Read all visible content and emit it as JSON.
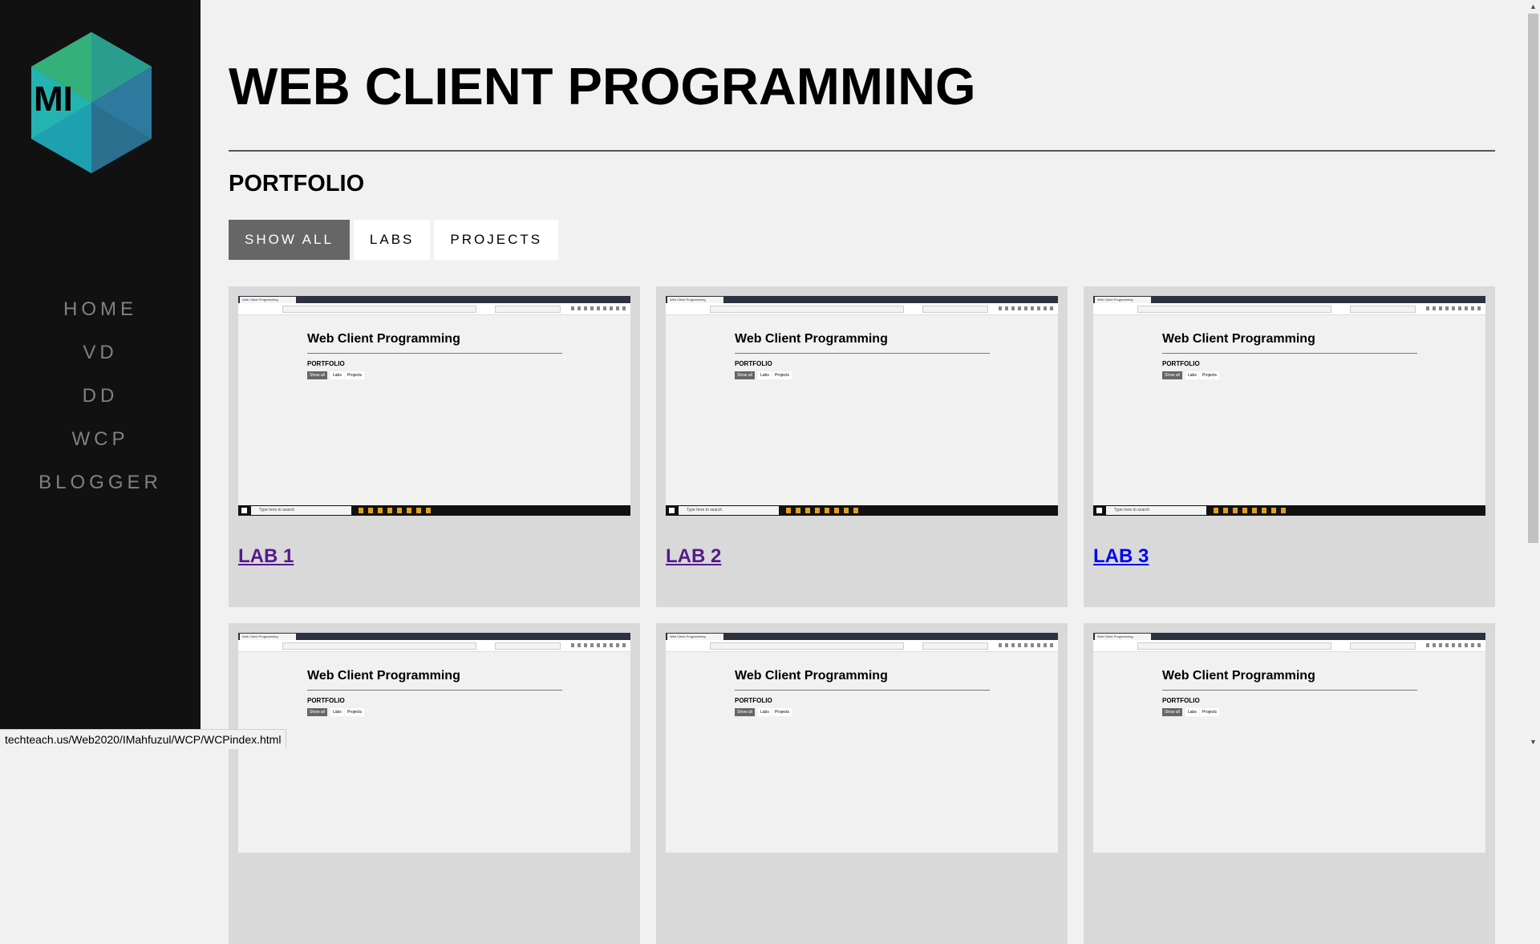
{
  "sidebar": {
    "logo_text": "MI",
    "nav": [
      "HOME",
      "VD",
      "DD",
      "WCP",
      "BLOGGER"
    ]
  },
  "header": {
    "title": "WEB CLIENT PROGRAMMING",
    "section": "PORTFOLIO"
  },
  "filters": {
    "show_all": "SHOW ALL",
    "labs": "LABS",
    "projects": "PROJECTS"
  },
  "cards": [
    {
      "link": "LAB 1",
      "visited": true
    },
    {
      "link": "LAB 2",
      "visited": true
    },
    {
      "link": "LAB 3",
      "visited": false
    }
  ],
  "thumbnail": {
    "tab_title": "Web Client Programming",
    "heading": "Web Client Programming",
    "section": "PORTFOLIO",
    "btn_show_all": "Show all",
    "btn_labs": "Labs",
    "btn_projects": "Projects",
    "taskbar_search": "Type here to search"
  },
  "status_bar": {
    "url": "techteach.us/Web2020/IMahfuzul/WCP/WCPindex.html"
  },
  "colors": {
    "sidebar_bg": "#111111",
    "nav_text": "#818181",
    "active_filter": "#666666",
    "visited_link": "#551a8b",
    "unvisited_link": "#0000ee"
  },
  "icons": [
    "logo-hexagon-icon",
    "scroll-up-arrow-icon",
    "scroll-down-arrow-icon"
  ]
}
